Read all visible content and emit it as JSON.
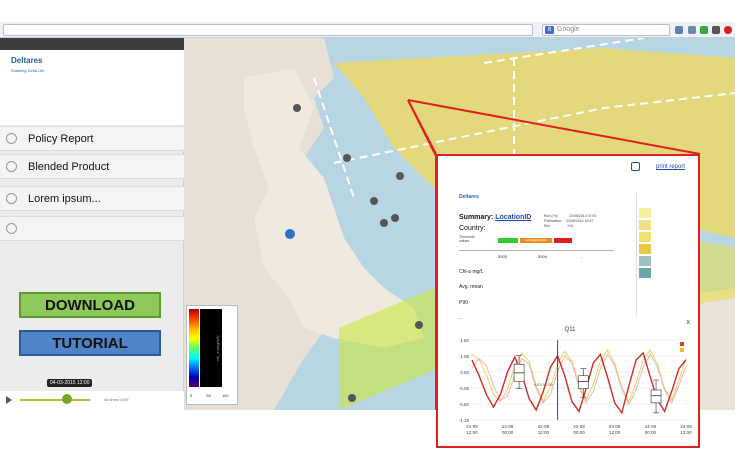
{
  "browser": {
    "url": "",
    "search_placeholder": "Google",
    "search_logo": "8"
  },
  "sidebar": {
    "logo": "Deltares",
    "logo_tagline": "Enabling Delta Life",
    "menu": [
      {
        "label": "Policy Report",
        "icon": "globe-icon"
      },
      {
        "label": "Blended Product",
        "icon": "globe-icon"
      },
      {
        "label": "Lorem ipsum...",
        "icon": "globe-icon"
      },
      {
        "label": "",
        "icon": "globe-icon"
      }
    ],
    "download_label": "DOWNLOAD",
    "tutorial_label": "TUTORIAL",
    "time_slider": {
      "tooltip": "04-03-2015 12:00",
      "position_fraction": 0.67,
      "timezone": "All times GMT"
    }
  },
  "map": {
    "legend_label": "chl_a (mg/m3)",
    "scale": [
      "0",
      "50",
      "100"
    ]
  },
  "report": {
    "print_label": "print report",
    "logo": "Deltares",
    "summary_prefix": "Summary:",
    "summary_location": "LocationID",
    "country_label": "Country:",
    "meta_lines": [
      "Run (Yr):",
      "Publication:",
      "Ref.:"
    ],
    "meta_values": [
      "22/08/2014 07:00",
      "22/08/2014 16:47",
      "XXL"
    ],
    "threshold_label": [
      "Threshold",
      "values"
    ],
    "thresholds": [
      {
        "label": "",
        "color": "#2ecc2e"
      },
      {
        "label": "EXCEEDANCE",
        "color": "#f08a1a"
      },
      {
        "label": "",
        "color": "#d92020"
      }
    ],
    "years": [
      "2003",
      "2004",
      "..."
    ],
    "unit": "Chl-a mg/L",
    "avg": "Avg. mean",
    "p90": "P90",
    "more": "...",
    "close": "x",
    "legend_colors": [
      "#f6f0a0",
      "#efe08a",
      "#f2e070",
      "#e8c84a",
      "#9fc0c0",
      "#6aa8a8"
    ]
  },
  "chart_data": {
    "type": "line",
    "title": "Q11",
    "ylim": [
      -1.2,
      1.6
    ],
    "yticks": [
      "1.60",
      "1.05",
      "0.50",
      "-0.05",
      "-0.60",
      "-1.15"
    ],
    "xticks": [
      "21-09\n12:00",
      "22-09\n00:00",
      "22-09\n12:00",
      "23-09\n00:00",
      "23-09\n12:00",
      "24-09\n00:00",
      "24-09\n12:00"
    ],
    "series": [
      {
        "name": "",
        "color": "#d12a2a",
        "values": [
          0.9,
          0.35,
          -0.3,
          -0.75,
          -0.3,
          0.5,
          1.0,
          0.4,
          -0.45,
          -0.85,
          -0.2,
          0.65,
          1.05,
          0.35,
          -0.55,
          -0.9,
          -0.1,
          0.8,
          1.1,
          0.3,
          -0.6,
          -0.95,
          0.0,
          0.9,
          1.15,
          0.3,
          -0.5,
          -0.9,
          -0.2,
          0.6,
          0.9
        ]
      },
      {
        "name": "",
        "color": "#f0b3b3",
        "values": [
          0.6,
          0.95,
          0.7,
          0.0,
          -0.5,
          -0.35,
          0.4,
          0.95,
          0.75,
          -0.1,
          -0.6,
          -0.3,
          0.5,
          1.05,
          0.8,
          -0.05,
          -0.6,
          -0.2,
          0.6,
          1.1,
          0.7,
          -0.1,
          -0.65,
          -0.15,
          0.65,
          1.1,
          0.65,
          -0.15,
          -0.6,
          0.0,
          0.7
        ]
      },
      {
        "name": "",
        "color": "#e8d35a",
        "values": [
          1.1,
          0.9,
          0.4,
          -0.3,
          -0.55,
          -0.1,
          0.7,
          1.15,
          0.85,
          0.0,
          -0.55,
          -0.05,
          0.75,
          1.2,
          0.85,
          0.05,
          -0.5,
          0.05,
          0.85,
          1.25,
          0.8,
          -0.05,
          -0.55,
          0.1,
          0.9,
          1.25,
          0.75,
          -0.1,
          -0.5,
          0.2,
          0.95
        ]
      }
    ],
    "boxes": [
      {
        "x": 0.22,
        "q1": 0.15,
        "q3": 0.75,
        "min": -0.1,
        "max": 1.05,
        "median": 0.45
      },
      {
        "x": 0.52,
        "q1": -0.1,
        "q3": 0.35,
        "min": -0.4,
        "max": 0.6,
        "median": 0.15
      },
      {
        "x": 0.86,
        "q1": -0.6,
        "q3": -0.15,
        "min": -0.95,
        "max": 0.2,
        "median": -0.35
      }
    ],
    "marker_line_fraction": 0.4,
    "marker_label": "4-03 12:00"
  }
}
